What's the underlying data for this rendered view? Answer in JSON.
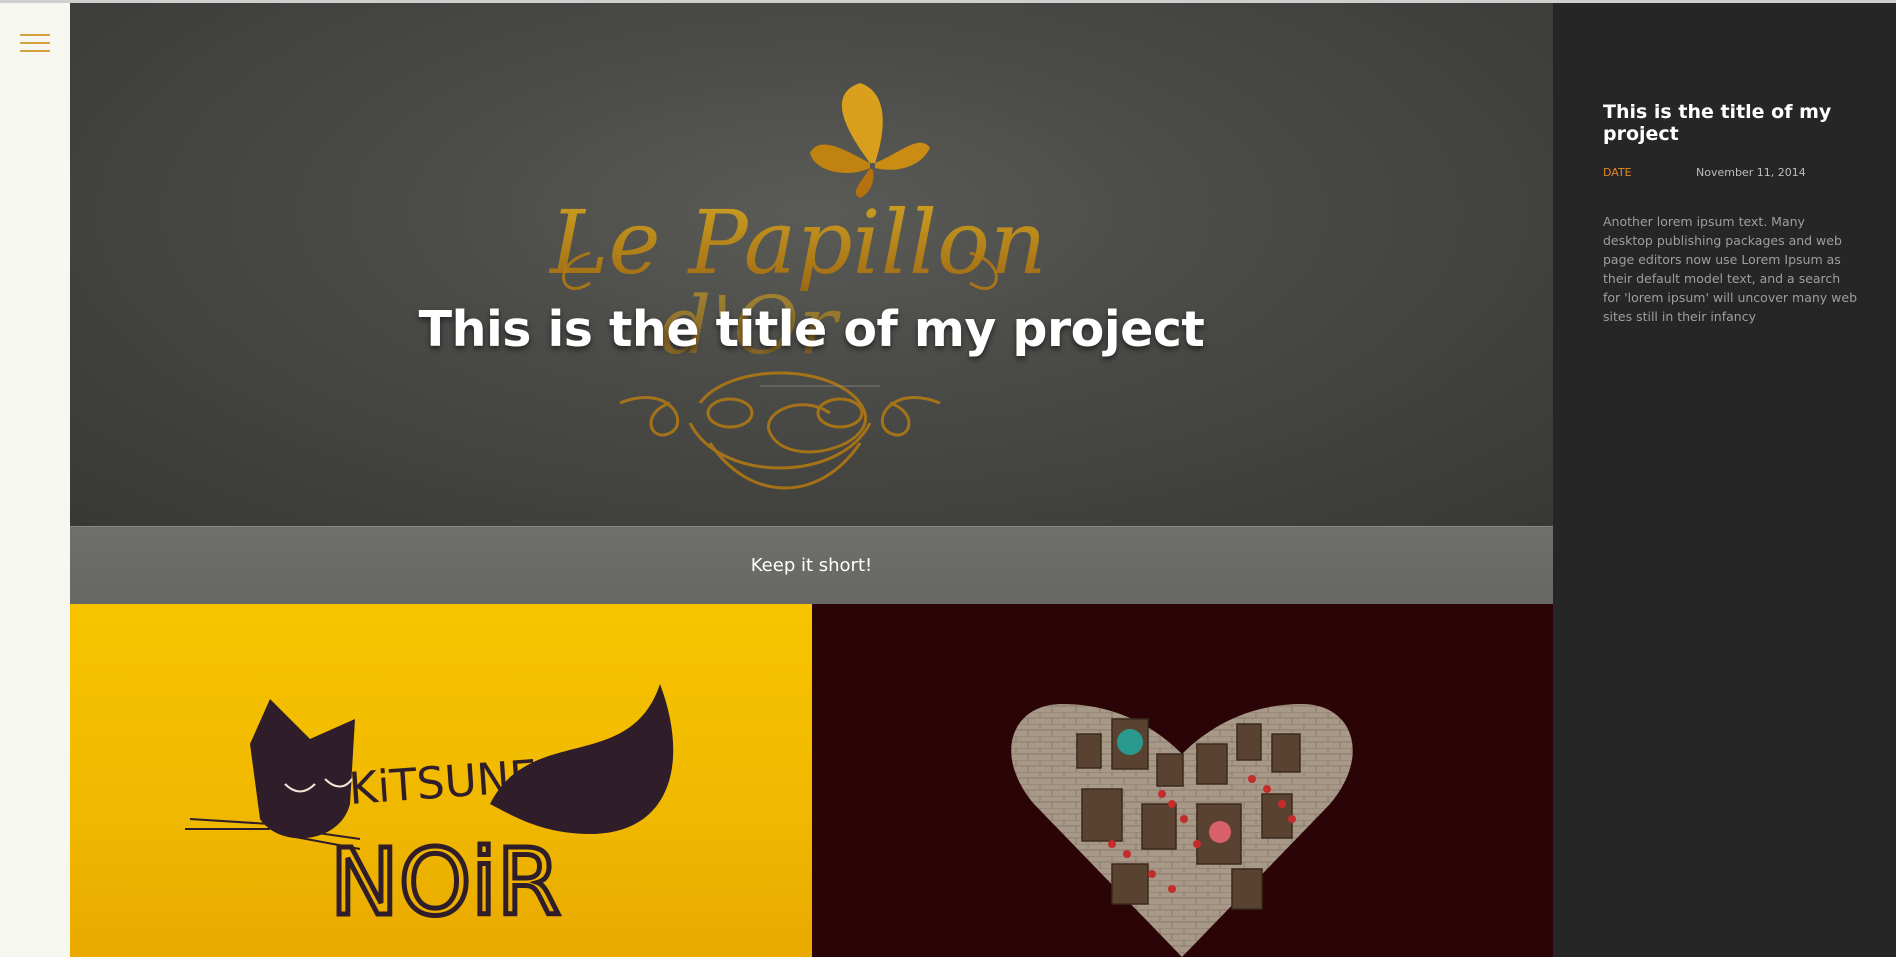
{
  "menu": {
    "icon": "hamburger-icon"
  },
  "hero": {
    "title": "This is the title of my project",
    "caption": "Keep it short!"
  },
  "sidebar": {
    "title": "This is the title of my project",
    "date_label": "DATE",
    "date_value": "November 11, 2014",
    "description": "Another lorem ipsum text. Many desktop publishing packages and web page editors now use Lorem Ipsum as their default model text, and a search for 'lorem ipsum' will uncover many web sites still in their infancy"
  },
  "gallery": [
    {
      "name": "kitsune-noir",
      "logo_text_1": "KiTSUNE",
      "logo_text_2": "NOiR"
    },
    {
      "name": "heart-windows"
    }
  ],
  "colors": {
    "accent": "#d4a13a",
    "date_label": "#e0872a",
    "sidebar_bg": "#262626",
    "hero_bg": "#4a4a47",
    "yellow_tile": "#f8c400",
    "maroon_tile": "#2a0406"
  }
}
